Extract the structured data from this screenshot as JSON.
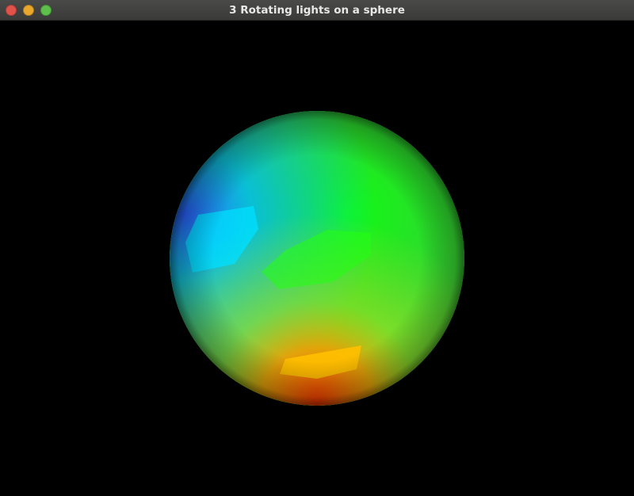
{
  "window": {
    "title": "3 Rotating lights on a sphere",
    "controls": {
      "close_icon": "close-icon",
      "minimize_icon": "minimize-icon",
      "maximize_icon": "maximize-icon"
    }
  },
  "scene": {
    "background_color": "#000000",
    "sphere": {
      "base_color": "#55d838",
      "lights": [
        {
          "color": "#2f6bff"
        },
        {
          "color": "#12ff10"
        },
        {
          "color": "#ff3a0a"
        }
      ]
    }
  }
}
